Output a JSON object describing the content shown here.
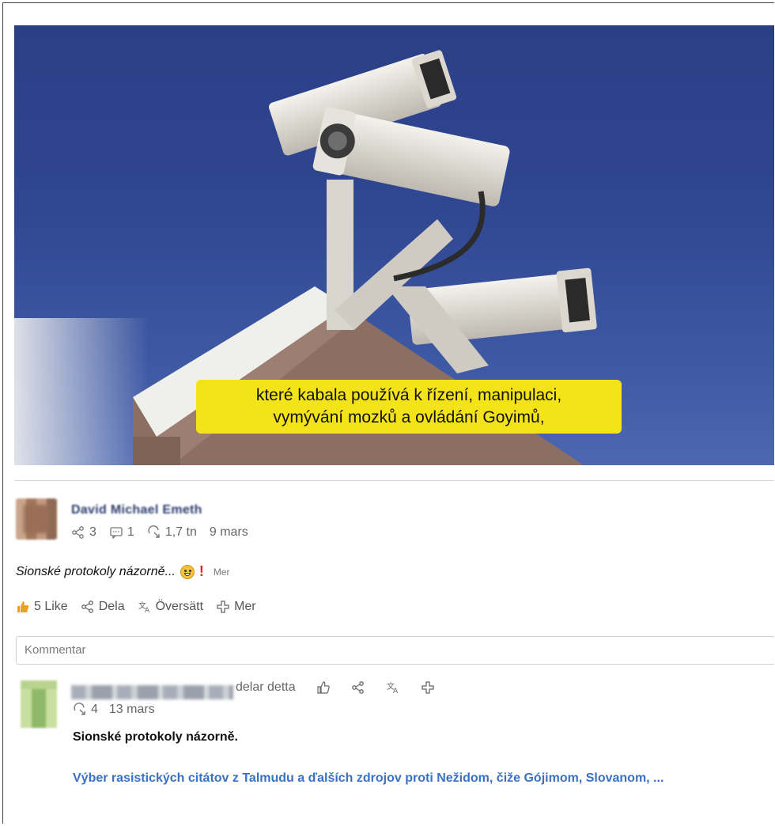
{
  "video": {
    "caption_line1": "které kabala používá k řízení, manipulaci,",
    "caption_line2": "vymývání mozků a ovládání Goyimů,"
  },
  "post": {
    "author": "David Michael Emeth",
    "shares": "3",
    "comments": "1",
    "views": "1,7 tn",
    "date": "9 mars",
    "text": "Sionské protokoly názorně...",
    "more_link": "Mer"
  },
  "actions": {
    "like": "5 Like",
    "share": "Dela",
    "translate": "Översätt",
    "more": "Mer"
  },
  "comment": {
    "placeholder": "Kommentar"
  },
  "share_item": {
    "action_text": "delar detta",
    "views": "4",
    "date": "13 mars",
    "title": "Sionské protokoly názorně.",
    "link_text": "Výber rasistických citátov z Talmudu a ďalších zdrojov proti Nežidom, čiže Gójimom, Slovanom, ..."
  },
  "colors": {
    "link": "#3a71c2",
    "caption_bg": "#f3e318",
    "like_icon": "#f0a020"
  }
}
